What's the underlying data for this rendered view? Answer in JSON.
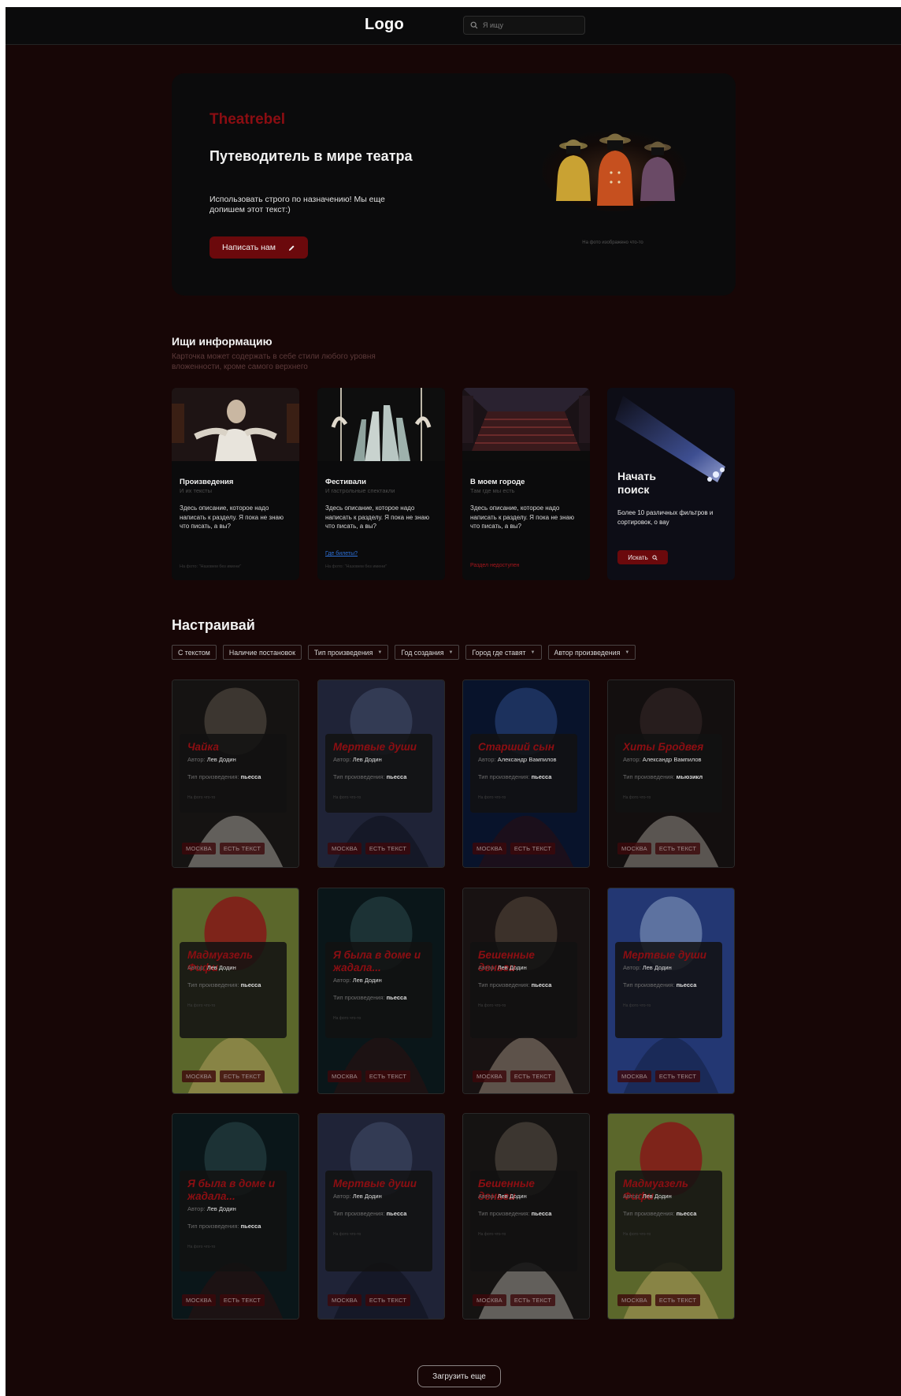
{
  "header": {
    "logo": "Logo",
    "search_placeholder": "Я ищу"
  },
  "hero": {
    "brand": "Theatrebel",
    "title": "Путеводитель в мире театра",
    "description": "Использовать строго по назначению! Мы еще допишем этот текст:)",
    "button_label": "Написать нам",
    "photo_caption": "На фото изображено что-то"
  },
  "info_section": {
    "title": "Ищи информацию",
    "subtitle": "Карточка может содержать в себе стили любого уровня вложенности, кроме самого верхнего",
    "cards": [
      {
        "title": "Произведения",
        "subtitle": "И их тексты",
        "description": "Здесь описание, которое надо написать к разделу. Я пока не знаю что писать, а вы?",
        "footer": "На фото: \"Назовем без имени\""
      },
      {
        "title": "Фестивали",
        "subtitle": "И гастрольные спектакли",
        "description": "Здесь описание, которое надо написать к разделу. Я пока не знаю что писать, а вы?",
        "link": "Где билеты?",
        "footer": "На фото: \"Назовем без имени\""
      },
      {
        "title": "В моем городе",
        "subtitle": "Там где мы есть",
        "description": "Здесь описание, которое надо написать к разделу. Я пока не знаю что писать, а вы?",
        "status": "Раздел недоступен"
      },
      {
        "title": "Начать поиск",
        "description": "Более 10 различных фильтров и сортировок, о вау",
        "button_label": "Искать"
      }
    ]
  },
  "filter_section": {
    "title": "Настраивай",
    "chips": [
      {
        "label": "С текстом",
        "dropdown": false
      },
      {
        "label": "Наличие постановок",
        "dropdown": false
      },
      {
        "label": "Тип произведения",
        "dropdown": true
      },
      {
        "label": "Год создания",
        "dropdown": true
      },
      {
        "label": "Город где ставят",
        "dropdown": true
      },
      {
        "label": "Автор произведения",
        "dropdown": true
      }
    ]
  },
  "works": {
    "author_label": "Автор:",
    "type_label": "Тип произведения:",
    "caption": "На фото что-то",
    "tag_city": "МОСКВА",
    "tag_text": "ЕСТЬ ТЕКСТ",
    "items": [
      {
        "title": "Чайка",
        "author": "Лев Додин",
        "type": "пьесса"
      },
      {
        "title": "Мертвые души",
        "author": "Лев Додин",
        "type": "пьесса"
      },
      {
        "title": "Старший сын",
        "author": "Александр Вампилов",
        "type": "пьесса"
      },
      {
        "title": "Хиты Бродвея",
        "author": "Александр Вампилов",
        "type": "мьюзикл"
      },
      {
        "title": "Мадмуазель Фифи",
        "author": "Лев Додин",
        "type": "пьесса"
      },
      {
        "title": "Я была в доме и жадала...",
        "author": "Лев Додин",
        "type": "пьесса"
      },
      {
        "title": "Бешенные деньги",
        "author": "Лев Додин",
        "type": "пьесса"
      },
      {
        "title": "Мертвые души",
        "author": "Лев Додин",
        "type": "пьесса"
      },
      {
        "title": "Я была в доме и жадала...",
        "author": "Лев Додин",
        "type": "пьесса"
      },
      {
        "title": "Мертвые души",
        "author": "Лев Додин",
        "type": "пьесса"
      },
      {
        "title": "Бешенные деньги",
        "author": "Лев Додин",
        "type": "пьесса"
      },
      {
        "title": "Мадмуазель Фифи",
        "author": "Лев Додин",
        "type": "пьесса"
      }
    ]
  },
  "load_more_label": "Загрузить еще"
}
